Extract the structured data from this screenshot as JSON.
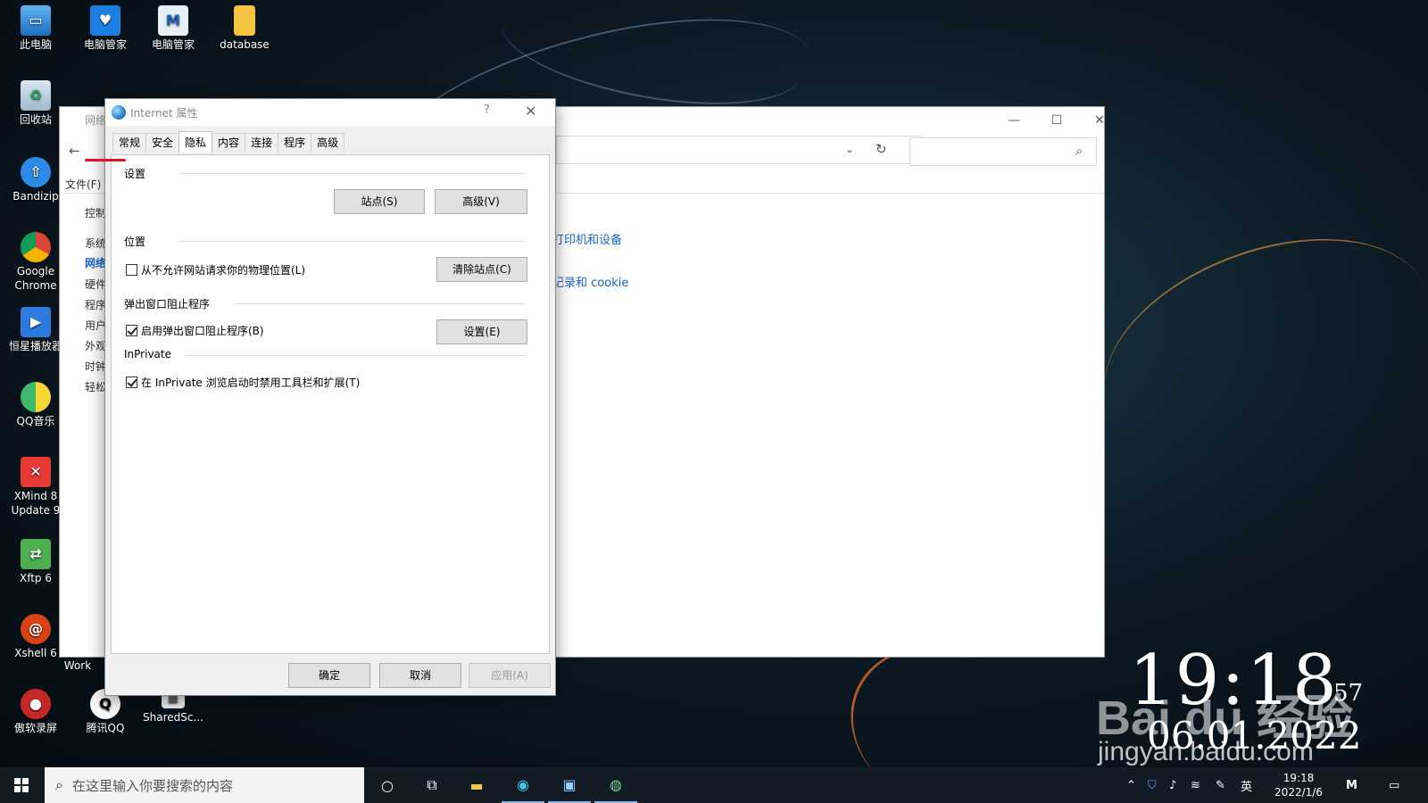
{
  "desktop": {
    "icons": [
      {
        "label": "此电脑"
      },
      {
        "label": "电脑管家"
      },
      {
        "label": "电脑管家"
      },
      {
        "label": "database"
      },
      {
        "label": "回收站"
      },
      {
        "label": "Bandizip"
      },
      {
        "label": "Google Chrome"
      },
      {
        "label": "恒星播放器"
      },
      {
        "label": "QQ音乐"
      },
      {
        "label": "XMind 8 Update 9"
      },
      {
        "label": "Xftp 6"
      },
      {
        "label": "Xshell 6"
      },
      {
        "label": "傲软录屏"
      },
      {
        "label": "腾讯QQ"
      },
      {
        "label": "SharedSc..."
      },
      {
        "label": "Work"
      }
    ]
  },
  "back_window": {
    "title": "网络",
    "menu_file": "文件(F)",
    "sidebar_items": [
      "控制",
      "系统",
      "网络",
      "硬件",
      "程序",
      "用户",
      "外观",
      "时钟",
      "轻松"
    ],
    "link_devices": "打印机和设备",
    "link_cookie": "记录和 cookie",
    "minimize": "—",
    "maximize": "☐",
    "close": "✕",
    "back_arrow": "←",
    "dropdown": "⌄",
    "refresh": "↻",
    "search_icon": "⌕"
  },
  "dialog": {
    "title": "Internet 属性",
    "help": "?",
    "close": "✕",
    "tabs": [
      "常规",
      "安全",
      "隐私",
      "内容",
      "连接",
      "程序",
      "高级"
    ],
    "active_tab": "隐私",
    "settings_label": "设置",
    "sites_button": "站点(S)",
    "advanced_button": "高级(V)",
    "location_label": "位置",
    "location_checkbox": "从不允许网站请求你的物理位置(L)",
    "clear_sites_button": "清除站点(C)",
    "popup_label": "弹出窗口阻止程序",
    "popup_checkbox": "启用弹出窗口阻止程序(B)",
    "popup_settings_button": "设置(E)",
    "inprivate_label": "InPrivate",
    "inprivate_checkbox": "在 InPrivate 浏览启动时禁用工具栏和扩展(T)",
    "ok_button": "确定",
    "cancel_button": "取消",
    "apply_button": "应用(A)"
  },
  "clock_widget": {
    "time": "19:18",
    "seconds": "57",
    "date": "06.01.2022"
  },
  "watermark": {
    "brand": "Bai du 经验",
    "url": "jingyan.baidu.com"
  },
  "taskbar": {
    "search_placeholder": "在这里输入你要搜索的内容",
    "tray_lang": "英",
    "tray_time": "19:18",
    "tray_date": "2022/1/6"
  },
  "colors": {
    "accent_tab": "#e81123",
    "link": "#1a64c8"
  }
}
